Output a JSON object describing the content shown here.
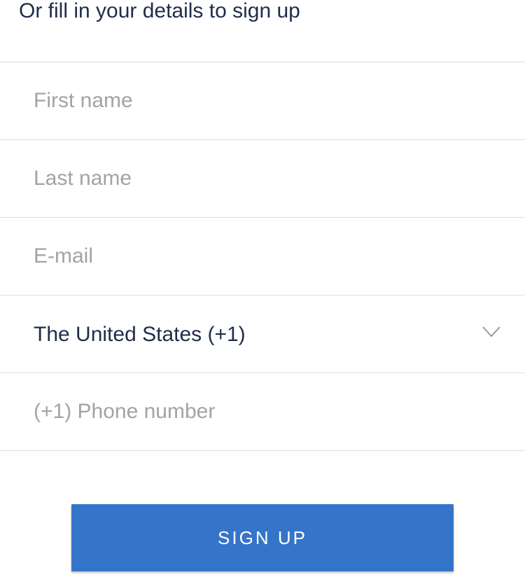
{
  "heading": "Or fill in your details to sign up",
  "form": {
    "first_name": {
      "placeholder": "First name",
      "value": ""
    },
    "last_name": {
      "placeholder": "Last name",
      "value": ""
    },
    "email": {
      "placeholder": "E-mail",
      "value": ""
    },
    "country": {
      "selected": "The United States (+1)",
      "icon": "chevron-down-icon"
    },
    "phone": {
      "placeholder": "(+1) Phone number",
      "value": ""
    }
  },
  "signup_button": {
    "label": "SIGN UP"
  },
  "colors": {
    "accent": "#3575c9",
    "text": "#1f2d4a",
    "placeholder": "#a3a3a3",
    "divider": "#dedede"
  }
}
